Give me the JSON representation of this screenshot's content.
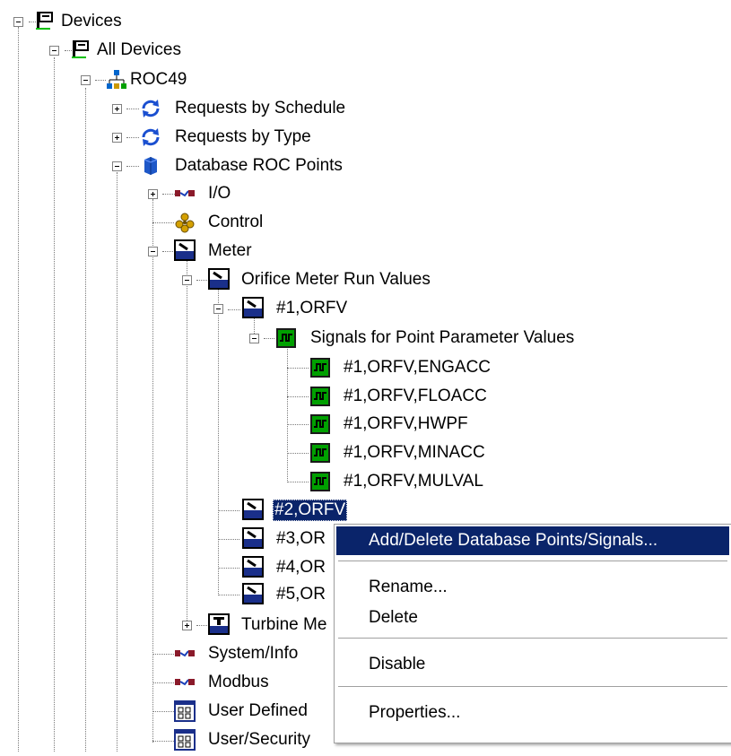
{
  "tree": {
    "devices": "Devices",
    "all_devices": "All Devices",
    "roc49": "ROC49",
    "requests_by_schedule": "Requests by Schedule",
    "requests_by_type": "Requests by Type",
    "database_roc_points": "Database ROC Points",
    "io": "I/O",
    "control": "Control",
    "meter": "Meter",
    "orifice_meter_run_values": "Orifice Meter Run Values",
    "orfv1": "#1,ORFV",
    "signals_for_point_parameter_values": "Signals for Point Parameter Values",
    "signals": [
      "#1,ORFV,ENGACC",
      "#1,ORFV,FLOACC",
      "#1,ORFV,HWPF",
      "#1,ORFV,MINACC",
      "#1,ORFV,MULVAL"
    ],
    "orfv2": "#2,ORFV",
    "orfv3": "#3,OR",
    "orfv4": "#4,OR",
    "orfv5": "#5,OR",
    "turbine_meter": "Turbine Me",
    "system_info": "System/Info",
    "modbus": "Modbus",
    "user_defined": "User Defined",
    "user_security": "User/Security"
  },
  "context_menu": {
    "add_delete": "Add/Delete Database Points/Signals...",
    "rename": "Rename...",
    "delete": "Delete",
    "disable": "Disable",
    "properties": "Properties..."
  },
  "colors": {
    "selection": "#0a246a",
    "signal_icon": "#00a000"
  }
}
